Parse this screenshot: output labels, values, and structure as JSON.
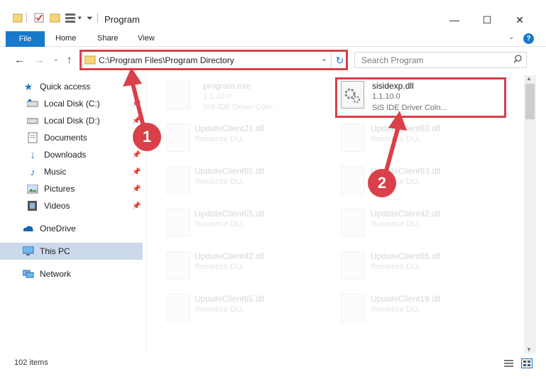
{
  "window": {
    "title": "Program",
    "minimize": "—",
    "maximize": "☐",
    "close": "✕"
  },
  "ribbon": {
    "tabs": [
      "File",
      "Home",
      "Share",
      "View"
    ],
    "help": "?"
  },
  "address": {
    "path": "C:\\Program Files\\Program Directory",
    "dropdown": "⌄",
    "refresh": "↻"
  },
  "search": {
    "placeholder": "Search Program"
  },
  "nav": {
    "items": [
      {
        "label": "Quick access"
      },
      {
        "label": "Local Disk (C:)"
      },
      {
        "label": "Local Disk (D:)"
      },
      {
        "label": "Documents"
      },
      {
        "label": "Downloads"
      },
      {
        "label": "Music"
      },
      {
        "label": "Pictures"
      },
      {
        "label": "Videos"
      },
      {
        "label": "OneDrive"
      },
      {
        "label": "This PC"
      },
      {
        "label": "Network"
      }
    ]
  },
  "files": [
    {
      "name": "program.exe",
      "line2": "1.1.10.0",
      "line3": "SiS IDE Driver Coln..."
    },
    {
      "name": "sisidexp.dll",
      "line2": "1.1.10.0",
      "line3": "SiS IDE Driver Coln..."
    },
    {
      "name": "UpdateClient21.dll",
      "line2": "Resource DLL"
    },
    {
      "name": "UpdateClient63.dll",
      "line2": "Resource DLL"
    },
    {
      "name": "UpdateClient65.dll",
      "line2": "Resource DLL"
    },
    {
      "name": "UpdateClient63.dll",
      "line2": "Resource DLL"
    },
    {
      "name": "UpdateClient65.dll",
      "line2": "Resource DLL"
    },
    {
      "name": "UpdateClient42.dll",
      "line2": "Resource DLL"
    },
    {
      "name": "UpdateClient42.dll",
      "line2": "Resource DLL"
    },
    {
      "name": "UpdateClient65.dll",
      "line2": "Resource DLL"
    },
    {
      "name": "UpdateClient65.dll",
      "line2": "Resource DLL"
    },
    {
      "name": "UpdateClient19.dll",
      "line2": "Resource DLL"
    }
  ],
  "annotations": {
    "step1": "1",
    "step2": "2"
  },
  "status": {
    "items": "102 items"
  },
  "colors": {
    "accent": "#1979ca",
    "annotation": "#d9404a",
    "selected": "#ccd9ea"
  }
}
